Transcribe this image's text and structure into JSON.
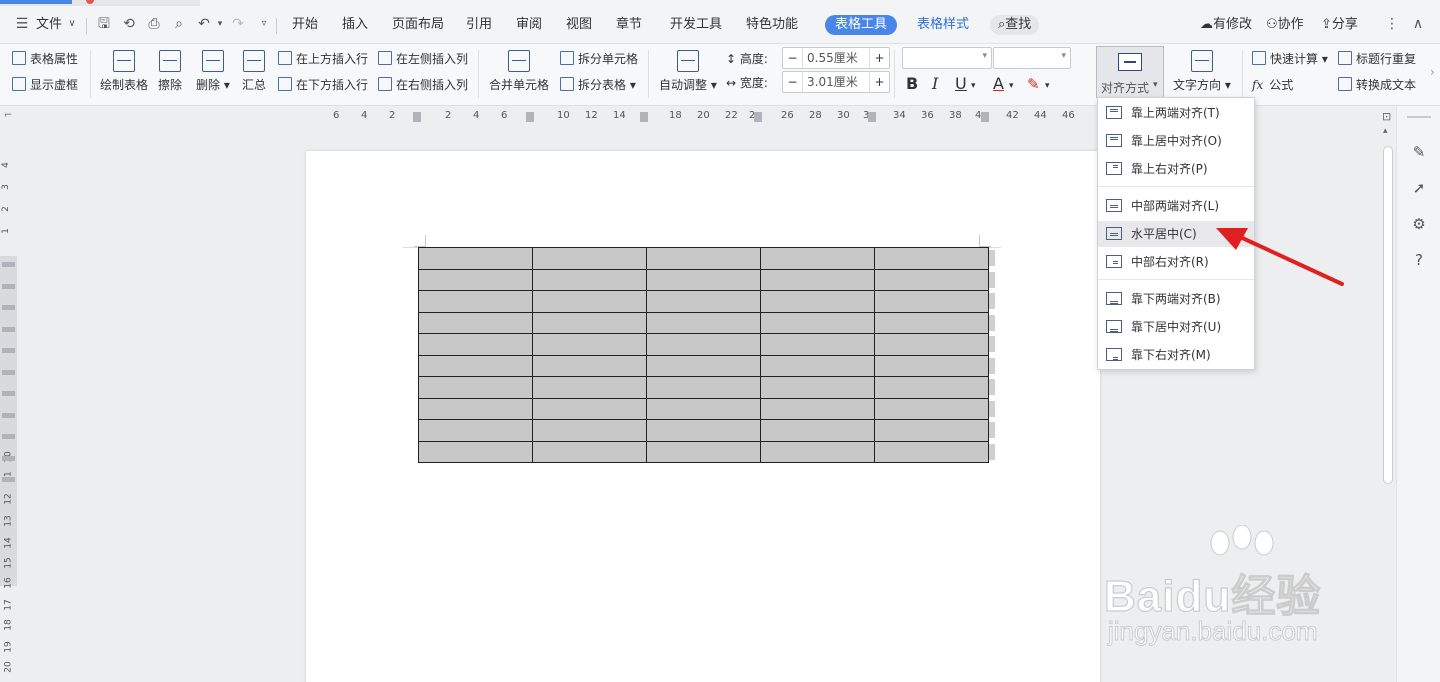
{
  "menu": {
    "file": "文件",
    "tabs": [
      "开始",
      "插入",
      "页面布局",
      "引用",
      "审阅",
      "视图",
      "章节",
      "开发工具",
      "特色功能",
      "表格工具",
      "表格样式"
    ],
    "search": "查找",
    "right": {
      "modified": "有修改",
      "collab": "协作",
      "share": "分享"
    }
  },
  "ribbon": {
    "table_props": "表格属性",
    "show_grid": "显示虚框",
    "draw_table": "绘制表格",
    "erase": "擦除",
    "delete": "删除",
    "summary": "汇总",
    "insert_row_above": "在上方插入行",
    "insert_row_below": "在下方插入行",
    "insert_col_left": "在左侧插入列",
    "insert_col_right": "在右侧插入列",
    "merge_cells": "合并单元格",
    "split_cells": "拆分单元格",
    "split_table": "拆分表格",
    "auto_fit": "自动调整",
    "height_label": "高度:",
    "height_value": "0.55厘米",
    "width_label": "宽度:",
    "width_value": "3.01厘米",
    "align": "对齐方式",
    "text_dir": "文字方向",
    "quick_calc": "快速计算",
    "repeat_header": "标题行重复",
    "formula": "公式",
    "to_text": "转换成文本",
    "bold": "B",
    "italic": "I",
    "underline": "U",
    "font_color": "A"
  },
  "hruler": [
    "6",
    "4",
    "2",
    "2",
    "4",
    "6",
    "10",
    "12",
    "14",
    "18",
    "20",
    "22",
    "2",
    "26",
    "28",
    "30",
    "3",
    "34",
    "36",
    "38",
    "4",
    "42",
    "44",
    "46"
  ],
  "vruler": [
    "4",
    "3",
    "2",
    "1",
    "10",
    "11",
    "12",
    "13",
    "14",
    "15",
    "16",
    "17",
    "18",
    "19",
    "20"
  ],
  "table": {
    "rows": 10,
    "cols": 5
  },
  "dropdown": {
    "items": [
      "靠上两端对齐(T)",
      "靠上居中对齐(O)",
      "靠上右对齐(P)",
      "中部两端对齐(L)",
      "水平居中(C)",
      "中部右对齐(R)",
      "靠下两端对齐(B)",
      "靠下居中对齐(U)",
      "靠下右对齐(M)"
    ],
    "highlighted_index": 4
  },
  "watermark": {
    "brand": "Bai",
    "du": "du",
    "jingyan": "经验",
    "url": "jingyan.baidu.com"
  },
  "colors": {
    "accent": "#4a86e8",
    "arrow": "#e02020",
    "cell": "#c8c8c8"
  }
}
